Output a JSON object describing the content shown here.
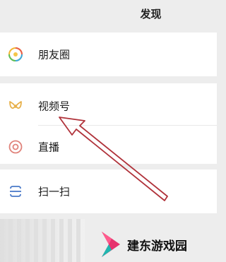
{
  "header": {
    "title": "发现"
  },
  "items": [
    {
      "label": "朋友圈",
      "icon": "moments-icon"
    },
    {
      "label": "视频号",
      "icon": "channels-icon"
    },
    {
      "label": "直播",
      "icon": "live-icon"
    },
    {
      "label": "扫一扫",
      "icon": "scan-icon"
    }
  ],
  "watermark": {
    "text": "建东游戏园"
  },
  "colors": {
    "page_background": "#ededed",
    "card_background": "#ffffff",
    "annotation_arrow": "#b0323a",
    "channels_icon": "#e7b04a",
    "live_icon": "#e0827a",
    "scan_icon": "#4a79c8"
  }
}
